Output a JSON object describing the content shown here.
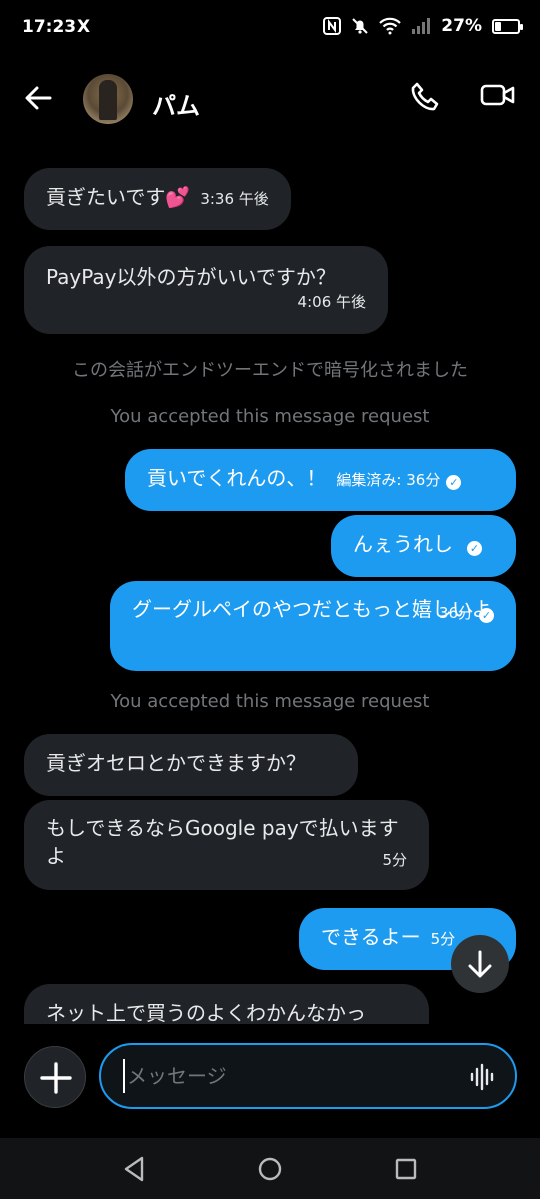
{
  "status": {
    "time": "17:23",
    "app_icon": "X",
    "battery_pct": "27%",
    "battery_level": 0.27
  },
  "header": {
    "contact_name": "パム"
  },
  "messages": {
    "m1": {
      "text": "貢ぎたいです💕",
      "time": "3:36 午後"
    },
    "m2": {
      "text": "PayPay以外の方がいいですか？",
      "time": "4:06 午後"
    },
    "encrypted_note": "この会話がエンドツーエンドで暗号化されました",
    "accepted_1": "You accepted this message request",
    "m3": {
      "text": "貢いでくれんの、！",
      "time": "編集済み: 36分"
    },
    "m4": {
      "text": "んぇうれし"
    },
    "m5": {
      "text": "グーグルペイのやつだともっと嬉しいよ",
      "time": "36分"
    },
    "accepted_2": "You accepted this message request",
    "m6": {
      "text": "貢ぎオセロとかできますか？"
    },
    "m7": {
      "text": "もしできるならGoogle payで払いますよ",
      "time": "5分"
    },
    "m8": {
      "text": "できるよー",
      "time": "5分"
    },
    "m9": {
      "text": "ネット上で買うのよくわかんなかっ"
    }
  },
  "composer": {
    "placeholder": "メッセージ"
  },
  "colors": {
    "accent": "#1d9bf0",
    "received_bubble": "#202327",
    "background": "#000000"
  }
}
